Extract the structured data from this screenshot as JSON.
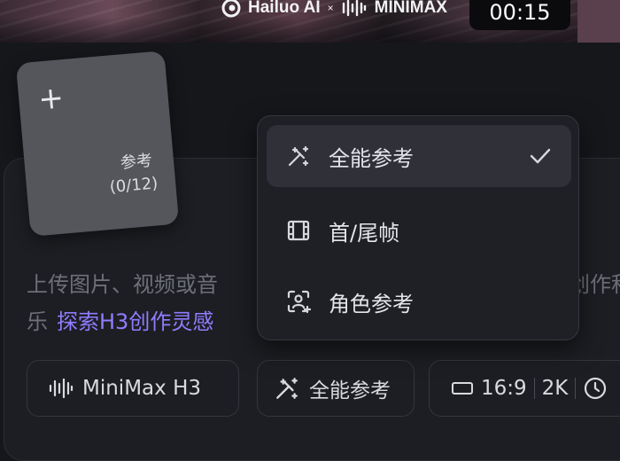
{
  "banner": {
    "brand_left": "Hailuo AI",
    "brand_x": "×",
    "brand_right": "MINIMAX",
    "timer": "00:15"
  },
  "upload": {
    "plus": "+",
    "label": "参考",
    "count": "(0/12)"
  },
  "hint": {
    "line1": "上传图片、视频或音",
    "line1_tail": "创作积",
    "line2_prefix": "乐",
    "explore_link": "探索H3创作灵感"
  },
  "dropdown": {
    "items": [
      {
        "label": "全能参考",
        "icon": "magic-wand-icon",
        "selected": true
      },
      {
        "label": "首/尾帧",
        "icon": "film-frame-icon",
        "selected": false
      },
      {
        "label": "角色参考",
        "icon": "character-scan-icon",
        "selected": false
      }
    ]
  },
  "toolbar": {
    "model_label": "MiniMax H3",
    "model_icon": "waveform-icon",
    "mode_label": "全能参考",
    "mode_icon": "magic-wand-icon",
    "aspect_ratio": "16:9",
    "resolution": "2K",
    "duration_icon": "clock-icon"
  },
  "colors": {
    "background": "#16171b",
    "accent_link": "#8f7cff",
    "dropdown_active": "#303138"
  }
}
